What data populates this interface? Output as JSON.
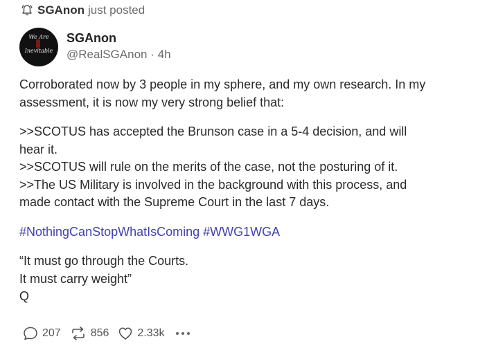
{
  "notice": {
    "author": "SGAnon",
    "action": "just posted",
    "icon": "bell-icon"
  },
  "post": {
    "display_name": "SGAnon",
    "handle": "@RealSGAnon",
    "separator": "·",
    "age": "4h",
    "avatar_text": [
      "We Are",
      "Inevitable"
    ],
    "lines": [
      "Corroborated now by 3 people in my sphere, and my own research.  In my",
      "assessment, it is now my very strong belief that:",
      "",
      ">>SCOTUS has accepted the Brunson case in a 5-4 decision, and will",
      "hear it.",
      ">>SCOTUS will rule on the merits of the case, not the posturing of it.",
      ">>The US Military is involved in the background with this process, and",
      "made contact with the Supreme Court in the last 7 days.",
      "",
      "#NothingCanStopWhatIsComing #WWG1WGA",
      "",
      "“It must go through the Courts.",
      "It must carry weight”",
      "Q"
    ]
  },
  "actions": {
    "comments": "207",
    "reposts": "856",
    "likes": "2.33k"
  },
  "colors": {
    "hashtag": "#3f3fb8",
    "muted": "#6b6b6b"
  }
}
